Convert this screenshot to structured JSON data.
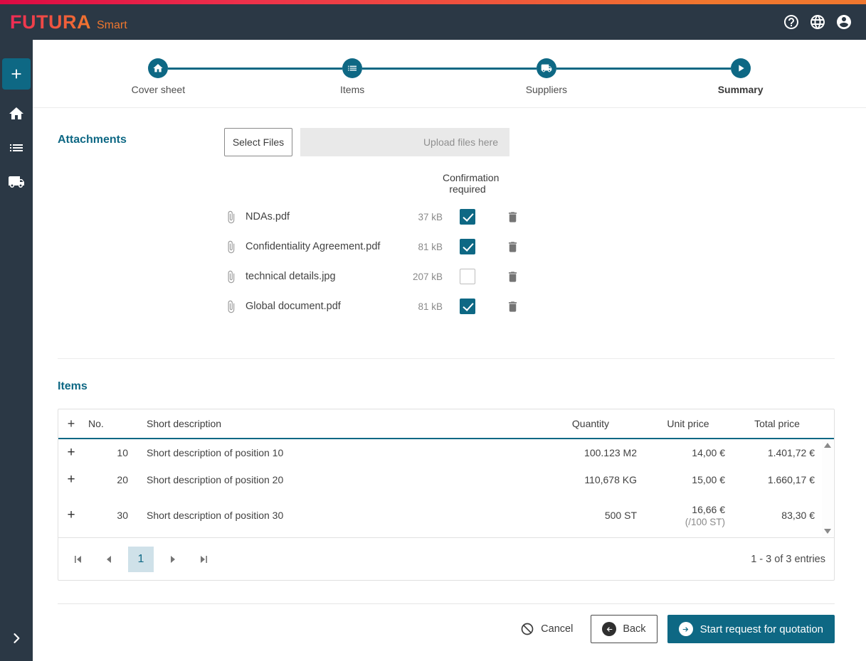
{
  "header": {
    "brand": "FUTURA",
    "brand_suffix": "Smart",
    "icons": [
      "help-icon",
      "language-globe-icon",
      "user-account-icon"
    ]
  },
  "sidebar": {
    "items": [
      "add-new",
      "home",
      "item-list",
      "suppliers-truck",
      "expand-menu"
    ]
  },
  "stepper": {
    "steps": [
      {
        "label": "Cover sheet",
        "icon": "home-icon",
        "active": false
      },
      {
        "label": "Items",
        "icon": "list-icon",
        "active": false
      },
      {
        "label": "Suppliers",
        "icon": "truck-icon",
        "active": false
      },
      {
        "label": "Summary",
        "icon": "play-icon",
        "active": true
      }
    ]
  },
  "attachments": {
    "title": "Attachments",
    "select_files_label": "Select Files",
    "upload_hint": "Upload files here",
    "confirmation_header": "Confirmation required",
    "files": [
      {
        "name": "NDAs.pdf",
        "size": "37 kB",
        "confirmed": true
      },
      {
        "name": "Confidentiality Agreement.pdf",
        "size": "81 kB",
        "confirmed": true
      },
      {
        "name": "technical details.jpg",
        "size": "207 kB",
        "confirmed": false
      },
      {
        "name": "Global document.pdf",
        "size": "81 kB",
        "confirmed": true
      }
    ]
  },
  "items": {
    "title": "Items",
    "expand_symbol": "+",
    "columns": {
      "no": "No.",
      "description": "Short description",
      "quantity": "Quantity",
      "unit_price": "Unit price",
      "total_price": "Total price"
    },
    "rows": [
      {
        "no": "10",
        "description": "Short description of position 10",
        "quantity": "100.123 M2",
        "unit_price": "14,00 €",
        "unit_price_note": "",
        "total_price": "1.401,72 €"
      },
      {
        "no": "20",
        "description": "Short description of position 20",
        "quantity": "110,678 KG",
        "unit_price": "15,00 €",
        "unit_price_note": "",
        "total_price": "1.660,17 €"
      },
      {
        "no": "30",
        "description": "Short description of position 30",
        "quantity": "500 ST",
        "unit_price": "16,66 €",
        "unit_price_note": "(/100 ST)",
        "total_price": "83,30 €"
      }
    ],
    "pagination": {
      "current_page": "1",
      "summary": "1 - 3 of 3 entries"
    }
  },
  "footer": {
    "cancel_label": "Cancel",
    "back_label": "Back",
    "submit_label": "Start request for quotation"
  },
  "colors": {
    "accent_teal": "#0E6884",
    "brand_orange": "#F0772E",
    "brand_red": "#DC0A43",
    "header_bg": "#2B3845",
    "upload_bg": "#E9E9E9",
    "page_box_bg": "#CFE1E9"
  }
}
